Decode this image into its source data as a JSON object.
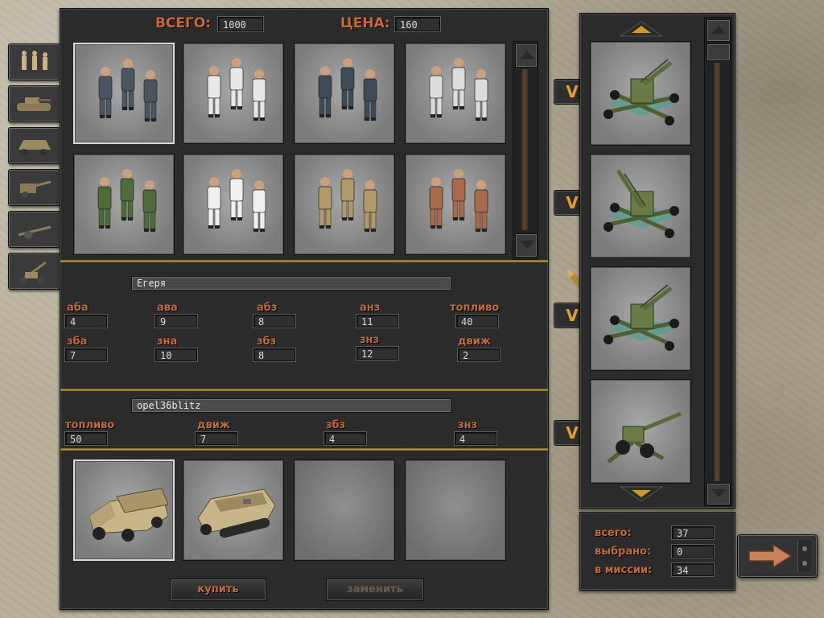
{
  "header": {
    "total_label": "ВСЕГО:",
    "total_value": "1000",
    "price_label": "ЦЕНА:",
    "price_value": "160"
  },
  "category_tabs": [
    {
      "name": "infantry-tab-icon"
    },
    {
      "name": "tank-tab-icon"
    },
    {
      "name": "armored-car-tab-icon"
    },
    {
      "name": "artillery-tab-icon"
    },
    {
      "name": "gun-tab-icon"
    },
    {
      "name": "aa-gun-tab-icon"
    }
  ],
  "unit_grid": [
    {
      "icon": "soldiers-grey-icon",
      "color": "#4a5560"
    },
    {
      "icon": "soldiers-white-icon",
      "color": "#e8e8e8"
    },
    {
      "icon": "soldiers-grey-icon",
      "color": "#3f4a58"
    },
    {
      "icon": "soldiers-white-icon",
      "color": "#dcdcdc"
    },
    {
      "icon": "soldiers-green-icon",
      "color": "#4f6b3a"
    },
    {
      "icon": "soldiers-white-icon",
      "color": "#f0f0f0"
    },
    {
      "icon": "soldiers-khaki-icon",
      "color": "#b09a6a"
    },
    {
      "icon": "soldiers-brown-icon",
      "color": "#a86a4a"
    }
  ],
  "unit_info": {
    "name": "Егеря",
    "stats": [
      {
        "label": "аба",
        "value": "4"
      },
      {
        "label": "ава",
        "value": "9"
      },
      {
        "label": "абз",
        "value": "8"
      },
      {
        "label": "анз",
        "value": "11"
      },
      {
        "label": "топливо",
        "value": "40"
      },
      {
        "label": "зба",
        "value": "7"
      },
      {
        "label": "зна",
        "value": "10"
      },
      {
        "label": "збз",
        "value": "8"
      },
      {
        "label": "знз",
        "value": "12"
      },
      {
        "label": "движ",
        "value": "2"
      }
    ]
  },
  "transport_info": {
    "name": "opel36blitz",
    "stats": [
      {
        "label": "топливо",
        "value": "50"
      },
      {
        "label": "движ",
        "value": "7"
      },
      {
        "label": "збз",
        "value": "4"
      },
      {
        "label": "знз",
        "value": "4"
      }
    ]
  },
  "transport_grid": [
    {
      "icon": "opel-blitz-truck-icon"
    },
    {
      "icon": "halftrack-icon"
    },
    {
      "icon": "empty-slot"
    },
    {
      "icon": "empty-slot"
    }
  ],
  "buttons": {
    "buy": "купить",
    "replace": "заменить"
  },
  "selected_list": [
    {
      "icon": "aa-gun-icon"
    },
    {
      "icon": "aa-gun-raised-icon"
    },
    {
      "icon": "aa-gun-icon"
    },
    {
      "icon": "field-gun-icon"
    }
  ],
  "select_button_glyph": "V",
  "summary": {
    "total_label": "всего:",
    "total_value": "37",
    "selected_label": "выбрано:",
    "selected_value": "0",
    "mission_label": "в миссии:",
    "mission_value": "34"
  },
  "colors": {
    "accent": "#c26a3c",
    "gold": "#c9a23d",
    "panel": "#2b2b2b"
  }
}
